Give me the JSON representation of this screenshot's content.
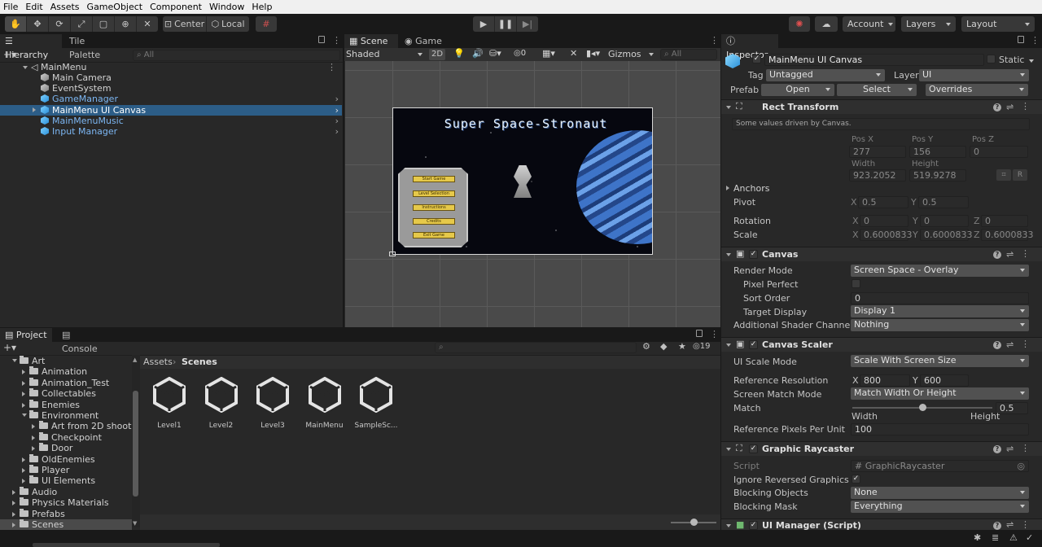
{
  "menubar": [
    "File",
    "Edit",
    "Assets",
    "GameObject",
    "Component",
    "Window",
    "Help"
  ],
  "toolbar": {
    "pivot_label": "Center",
    "space_label": "Local",
    "account_label": "Account",
    "layers_label": "Layers",
    "layout_label": "Layout"
  },
  "hierarchy": {
    "tabs": [
      "Hierarchy",
      "Tile Palette"
    ],
    "search_placeholder": "All",
    "scene_name": "MainMenu",
    "items": [
      {
        "label": "Main Camera",
        "type": "object"
      },
      {
        "label": "EventSystem",
        "type": "object"
      },
      {
        "label": "GameManager",
        "type": "prefab"
      },
      {
        "label": "MainMenu UI Canvas",
        "type": "prefab",
        "selected": true
      },
      {
        "label": "MainMenuMusic",
        "type": "prefab"
      },
      {
        "label": "Input Manager",
        "type": "prefab"
      }
    ]
  },
  "scene": {
    "tabs": [
      "Scene",
      "Game"
    ],
    "shading": "Shaded",
    "mode_2d": "2D",
    "hidden_count": "0",
    "gizmos": "Gizmos",
    "search_placeholder": "All",
    "game_title": "Super Space-Stronaut",
    "menu_buttons": [
      "Start Game",
      "Level Selection",
      "Instructions",
      "Credits",
      "Exit Game"
    ]
  },
  "inspector": {
    "tab": "Inspector",
    "object_name": "MainMenu UI Canvas",
    "static_label": "Static",
    "tag_label": "Tag",
    "tag_value": "Untagged",
    "layer_label": "Layer",
    "layer_value": "UI",
    "prefab_label": "Prefab",
    "open_label": "Open",
    "select_label": "Select",
    "overrides_label": "Overrides",
    "rect_transform": {
      "title": "Rect Transform",
      "note": "Some values driven by Canvas.",
      "pos_x_label": "Pos X",
      "pos_y_label": "Pos Y",
      "pos_z_label": "Pos Z",
      "pos_x": "277",
      "pos_y": "156",
      "pos_z": "0",
      "width_label": "Width",
      "height_label": "Height",
      "width": "923.2052",
      "height": "519.9278",
      "r_label": "R",
      "anchors_label": "Anchors",
      "pivot_label": "Pivot",
      "pivot_x": "0.5",
      "pivot_y": "0.5",
      "rotation_label": "Rotation",
      "rot_x": "0",
      "rot_y": "0",
      "rot_z": "0",
      "scale_label": "Scale",
      "scale_x": "0.6000833",
      "scale_y": "0.6000833",
      "scale_z": "0.6000833"
    },
    "canvas": {
      "title": "Canvas",
      "render_mode_label": "Render Mode",
      "render_mode": "Screen Space - Overlay",
      "pixel_perfect_label": "Pixel Perfect",
      "sort_order_label": "Sort Order",
      "sort_order": "0",
      "target_display_label": "Target Display",
      "target_display": "Display 1",
      "shader_channels_label": "Additional Shader Channels",
      "shader_channels": "Nothing"
    },
    "canvas_scaler": {
      "title": "Canvas Scaler",
      "ui_scale_label": "UI Scale Mode",
      "ui_scale": "Scale With Screen Size",
      "ref_res_label": "Reference Resolution",
      "ref_x": "800",
      "ref_y": "600",
      "match_mode_label": "Screen Match Mode",
      "match_mode": "Match Width Or Height",
      "match_label": "Match",
      "match_value": "0.5",
      "match_fraction": 0.5,
      "width_label": "Width",
      "height_label": "Height",
      "ppu_label": "Reference Pixels Per Unit",
      "ppu": "100"
    },
    "raycaster": {
      "title": "Graphic Raycaster",
      "script_label": "Script",
      "script": "GraphicRaycaster",
      "ignore_label": "Ignore Reversed Graphics",
      "blocking_objects_label": "Blocking Objects",
      "blocking_objects": "None",
      "blocking_mask_label": "Blocking Mask",
      "blocking_mask": "Everything"
    },
    "ui_manager": {
      "title": "UI Manager (Script)"
    }
  },
  "project": {
    "tabs": [
      "Project",
      "Console"
    ],
    "hidden_count": "19",
    "breadcrumb": [
      "Assets",
      "Scenes"
    ],
    "tree": [
      {
        "label": "Art",
        "depth": 0,
        "open": true
      },
      {
        "label": "Animation",
        "depth": 1
      },
      {
        "label": "Animation_Test",
        "depth": 1
      },
      {
        "label": "Collectables",
        "depth": 1
      },
      {
        "label": "Enemies",
        "depth": 1
      },
      {
        "label": "Environment",
        "depth": 1,
        "open": true
      },
      {
        "label": "Art from 2D shooter",
        "depth": 2
      },
      {
        "label": "Checkpoint",
        "depth": 2
      },
      {
        "label": "Door",
        "depth": 2
      },
      {
        "label": "OldEnemies",
        "depth": 1
      },
      {
        "label": "Player",
        "depth": 1
      },
      {
        "label": "UI Elements",
        "depth": 1
      },
      {
        "label": "Audio",
        "depth": 0
      },
      {
        "label": "Physics Materials",
        "depth": 0
      },
      {
        "label": "Prefabs",
        "depth": 0
      },
      {
        "label": "Scenes",
        "depth": 0,
        "selected": true
      }
    ],
    "assets": [
      "Level1",
      "Level2",
      "Level3",
      "MainMenu",
      "SampleSc..."
    ]
  }
}
